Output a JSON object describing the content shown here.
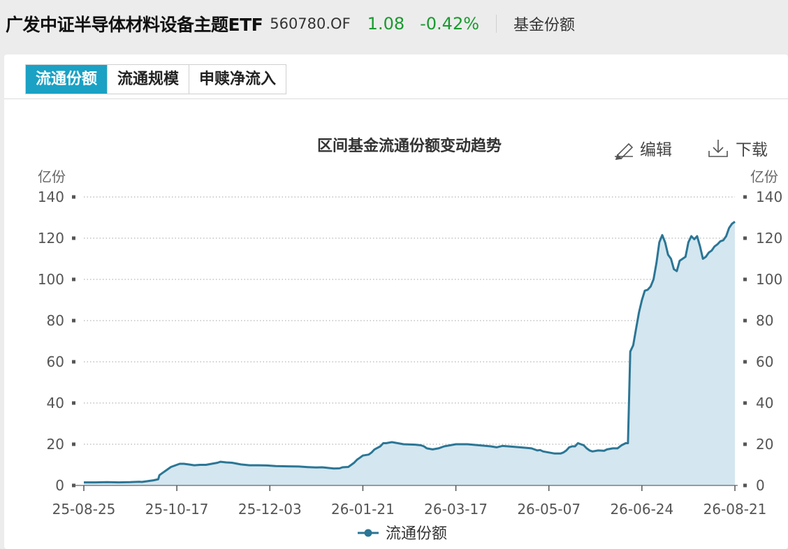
{
  "header": {
    "fund_name": "广发中证半导体材料设备主题ETF",
    "fund_code": "560780.OF",
    "price": "1.08",
    "change": "-0.42%",
    "section": "基金份额",
    "price_color": "#1a9a2f"
  },
  "tabs": [
    {
      "label": "流通份额",
      "active": true
    },
    {
      "label": "流通规模",
      "active": false
    },
    {
      "label": "申赎净流入",
      "active": false
    }
  ],
  "toolbar": {
    "edit_label": "编辑",
    "download_label": "下载"
  },
  "colors": {
    "accent": "#1aa1c4",
    "line": "#2b7695",
    "area": "#d4e6ef"
  },
  "chart_data": {
    "type": "area",
    "title": "区间基金流通份额变动趋势",
    "ylabel_left": "亿份",
    "ylabel_right": "亿份",
    "ylim": [
      0,
      140
    ],
    "y_ticks": [
      0,
      20,
      40,
      60,
      80,
      100,
      120,
      140
    ],
    "x_tick_labels": [
      "25-08-25",
      "25-10-17",
      "25-12-03",
      "26-01-21",
      "26-03-17",
      "26-05-07",
      "26-06-24",
      "26-08-21"
    ],
    "grid": true,
    "legend_position": "bottom",
    "series": [
      {
        "name": "流通份额",
        "points": [
          [
            0.0,
            1.5
          ],
          [
            0.02,
            1.5
          ],
          [
            0.04,
            1.6
          ],
          [
            0.06,
            1.5
          ],
          [
            0.08,
            1.6
          ],
          [
            0.095,
            1.8
          ],
          [
            0.1,
            1.7
          ],
          [
            0.12,
            2.5
          ],
          [
            0.128,
            3.0
          ],
          [
            0.13,
            5.0
          ],
          [
            0.135,
            6.0
          ],
          [
            0.14,
            7.0
          ],
          [
            0.145,
            8.0
          ],
          [
            0.15,
            9.0
          ],
          [
            0.155,
            9.5
          ],
          [
            0.16,
            10.0
          ],
          [
            0.165,
            10.5
          ],
          [
            0.172,
            10.5
          ],
          [
            0.18,
            10.2
          ],
          [
            0.19,
            9.8
          ],
          [
            0.2,
            10.0
          ],
          [
            0.21,
            10.0
          ],
          [
            0.22,
            10.5
          ],
          [
            0.23,
            11.0
          ],
          [
            0.235,
            11.5
          ],
          [
            0.245,
            11.2
          ],
          [
            0.255,
            11.0
          ],
          [
            0.27,
            10.2
          ],
          [
            0.285,
            9.8
          ],
          [
            0.3,
            9.8
          ],
          [
            0.315,
            9.7
          ],
          [
            0.33,
            9.4
          ],
          [
            0.35,
            9.3
          ],
          [
            0.37,
            9.2
          ],
          [
            0.385,
            8.9
          ],
          [
            0.4,
            8.7
          ],
          [
            0.41,
            8.8
          ],
          [
            0.42,
            8.5
          ],
          [
            0.43,
            8.2
          ],
          [
            0.44,
            8.3
          ],
          [
            0.445,
            8.8
          ],
          [
            0.455,
            9.0
          ],
          [
            0.46,
            10.0
          ],
          [
            0.465,
            11.0
          ],
          [
            0.47,
            12.5
          ],
          [
            0.475,
            13.5
          ],
          [
            0.48,
            14.5
          ],
          [
            0.49,
            15.0
          ],
          [
            0.495,
            16.0
          ],
          [
            0.5,
            17.5
          ],
          [
            0.51,
            19.0
          ],
          [
            0.515,
            20.5
          ],
          [
            0.52,
            20.5
          ],
          [
            0.53,
            21.0
          ],
          [
            0.54,
            20.5
          ],
          [
            0.55,
            20.0
          ],
          [
            0.57,
            19.8
          ],
          [
            0.58,
            19.5
          ],
          [
            0.585,
            19.0
          ],
          [
            0.59,
            18.0
          ],
          [
            0.6,
            17.5
          ],
          [
            0.61,
            18.0
          ],
          [
            0.62,
            19.0
          ],
          [
            0.63,
            19.5
          ],
          [
            0.64,
            20.0
          ],
          [
            0.66,
            20.0
          ],
          [
            0.68,
            19.5
          ],
          [
            0.7,
            19.0
          ],
          [
            0.71,
            18.5
          ],
          [
            0.72,
            19.2
          ],
          [
            0.73,
            19.0
          ],
          [
            0.75,
            18.5
          ],
          [
            0.77,
            18.0
          ],
          [
            0.78,
            17.0
          ],
          [
            0.785,
            17.2
          ],
          [
            0.79,
            16.5
          ],
          [
            0.8,
            16.0
          ],
          [
            0.81,
            15.5
          ],
          [
            0.82,
            15.5
          ],
          [
            0.825,
            16.0
          ],
          [
            0.83,
            17.0
          ],
          [
            0.835,
            18.5
          ],
          [
            0.84,
            19.0
          ],
          [
            0.845,
            19.0
          ],
          [
            0.85,
            20.5
          ],
          [
            0.855,
            20.0
          ],
          [
            0.86,
            19.5
          ],
          [
            0.865,
            18.0
          ],
          [
            0.87,
            17.0
          ],
          [
            0.875,
            16.5
          ],
          [
            0.885,
            17.0
          ],
          [
            0.895,
            16.8
          ],
          [
            0.9,
            17.5
          ],
          [
            0.91,
            18.0
          ],
          [
            0.918,
            18.0
          ],
          [
            0.925,
            19.5
          ],
          [
            0.932,
            20.5
          ],
          [
            0.936,
            20.5
          ],
          [
            0.94,
            65.0
          ],
          [
            0.945,
            68.0
          ],
          [
            0.95,
            76.0
          ],
          [
            0.955,
            84.0
          ],
          [
            0.96,
            90.0
          ],
          [
            0.965,
            94.5
          ],
          [
            0.97,
            95.0
          ],
          [
            0.975,
            96.5
          ],
          [
            0.98,
            100.0
          ],
          [
            0.985,
            108.0
          ],
          [
            0.99,
            118.0
          ],
          [
            0.995,
            121.5
          ],
          [
            1.0,
            118.0
          ],
          [
            1.005,
            112.0
          ],
          [
            1.01,
            110.0
          ],
          [
            1.015,
            105.0
          ],
          [
            1.02,
            104.0
          ],
          [
            1.025,
            109.0
          ],
          [
            1.03,
            110.0
          ],
          [
            1.035,
            111.0
          ],
          [
            1.04,
            118.0
          ],
          [
            1.045,
            121.0
          ],
          [
            1.05,
            119.5
          ],
          [
            1.055,
            121.0
          ],
          [
            1.06,
            116.0
          ],
          [
            1.065,
            110.0
          ],
          [
            1.07,
            111.0
          ],
          [
            1.075,
            113.0
          ],
          [
            1.08,
            114.0
          ],
          [
            1.085,
            116.0
          ],
          [
            1.09,
            117.0
          ],
          [
            1.095,
            118.5
          ],
          [
            1.1,
            119.0
          ],
          [
            1.105,
            121.0
          ],
          [
            1.11,
            125.0
          ],
          [
            1.115,
            127.0
          ],
          [
            1.12,
            128.0
          ]
        ]
      }
    ]
  }
}
